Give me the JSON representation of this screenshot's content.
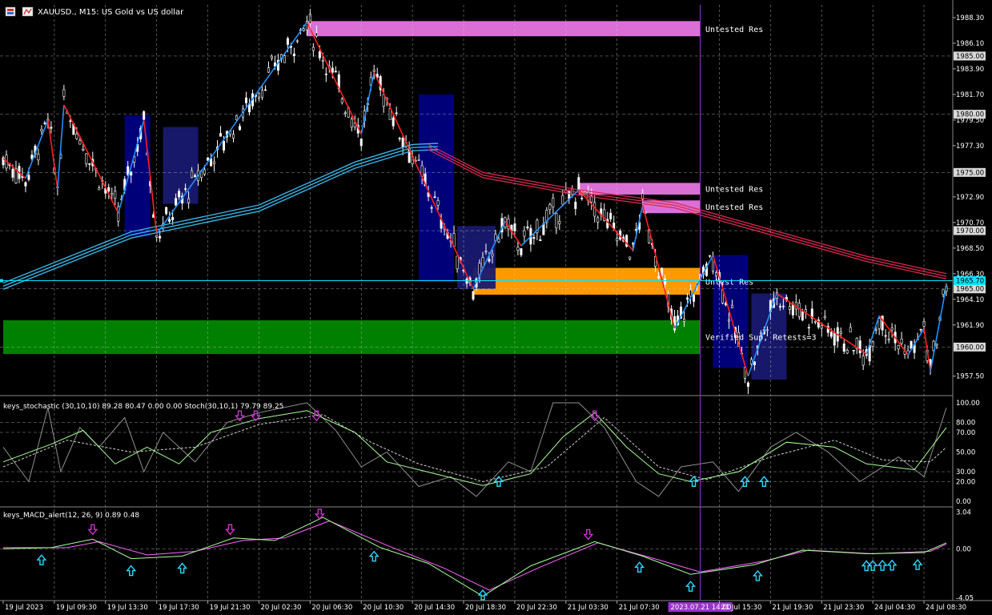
{
  "window": {
    "symbol_title": "XAUUSD., M15:  US Gold vs US dollar",
    "icons": [
      "chart-type-icon",
      "trade-icon"
    ]
  },
  "colors": {
    "background": "#000000",
    "grid": "#c8c8c8",
    "bull": "#ffffff",
    "bear": "#ffffff",
    "zigzag_up": "#1e90ff",
    "zigzag_down": "#ff2020",
    "ma": "#36b4e6",
    "ma_slow": "#dc2850",
    "zone_violet": "#da70d6",
    "zone_orange": "#ff9900",
    "zone_green": "#008000",
    "zone_navy": "#000080",
    "zone_blue": "#191970",
    "price_line": "#00e5ff",
    "stoch_main": "#a8ff9a",
    "stoch_signal": "#d0d0d0",
    "stoch_fast": "#909090",
    "macd_main": "#a8ff9a",
    "macd_signal": "#ff66ff",
    "arrow_up": "#29d9ff",
    "arrow_down": "#cc33cc",
    "axis_highlight": "#9933cc"
  },
  "price_axis": {
    "min": 1955.9,
    "max": 1989.4,
    "tick_labels": [
      "1988.30",
      "1986.10",
      "1983.90",
      "1981.70",
      "1979.50",
      "1977.30",
      "1972.90",
      "1970.70",
      "1968.50",
      "1966.30",
      "1964.10",
      "1961.90",
      "1957.50"
    ],
    "boxed_labels": [
      "1985.00",
      "1980.00",
      "1975.00",
      "1970.00",
      "1965.00",
      "1960.00"
    ],
    "current_price": "1965.70",
    "dashed_levels": [
      1985,
      1980,
      1975,
      1970,
      1965,
      1960
    ]
  },
  "zones": [
    {
      "label": "Untested Res",
      "kind": "violet",
      "from_index": 95,
      "to_index": 218,
      "top": 1988.0,
      "bottom": 1986.7
    },
    {
      "label": "Untested Res",
      "kind": "violet",
      "from_index": 180,
      "to_index": 218,
      "top": 1974.1,
      "bottom": 1973.1
    },
    {
      "label": "Untested Res",
      "kind": "violet",
      "from_index": 200,
      "to_index": 218,
      "top": 1972.6,
      "bottom": 1971.5
    },
    {
      "label": "Untest Res",
      "kind": "orange",
      "from_index": 147,
      "to_index": 218,
      "top": 1966.8,
      "bottom": 1964.5
    },
    {
      "label": "Verified Sup, Retests=3",
      "kind": "green",
      "from_index": 0,
      "to_index": 218,
      "top": 1962.3,
      "bottom": 1959.4
    }
  ],
  "blue_boxes": [
    {
      "kind": "navy",
      "from_index": 38,
      "to_index": 46,
      "top": 1979.9,
      "bottom": 1969.5
    },
    {
      "kind": "blue",
      "from_index": 50,
      "to_index": 61,
      "top": 1978.9,
      "bottom": 1972.3
    },
    {
      "kind": "navy",
      "from_index": 130,
      "to_index": 141,
      "top": 1981.7,
      "bottom": 1965.6
    },
    {
      "kind": "blue",
      "from_index": 142,
      "to_index": 154,
      "top": 1970.4,
      "bottom": 1965.0
    },
    {
      "kind": "navy",
      "from_index": 222,
      "to_index": 233,
      "top": 1967.9,
      "bottom": 1958.2
    },
    {
      "kind": "blue",
      "from_index": 234,
      "to_index": 245,
      "top": 1964.6,
      "bottom": 1957.2
    }
  ],
  "zigzag": [
    {
      "i": 0,
      "p": 1976.2
    },
    {
      "i": 7,
      "p": 1974.5
    },
    {
      "i": 14,
      "p": 1979.5
    },
    {
      "i": 17,
      "p": 1973.6
    },
    {
      "i": 19,
      "p": 1980.8
    },
    {
      "i": 36,
      "p": 1971.5
    },
    {
      "i": 44,
      "p": 1979.5
    },
    {
      "i": 48,
      "p": 1969.7
    },
    {
      "i": 95,
      "p": 1987.9
    },
    {
      "i": 112,
      "p": 1978.3
    },
    {
      "i": 116,
      "p": 1983.6
    },
    {
      "i": 147,
      "p": 1965.0
    },
    {
      "i": 157,
      "p": 1970.8
    },
    {
      "i": 162,
      "p": 1968.7
    },
    {
      "i": 180,
      "p": 1973.5
    },
    {
      "i": 197,
      "p": 1968.3
    },
    {
      "i": 200,
      "p": 1972.2
    },
    {
      "i": 210,
      "p": 1961.6
    },
    {
      "i": 222,
      "p": 1967.9
    },
    {
      "i": 233,
      "p": 1957.5
    },
    {
      "i": 242,
      "p": 1964.6
    },
    {
      "i": 270,
      "p": 1959.4
    },
    {
      "i": 274,
      "p": 1962.7
    },
    {
      "i": 283,
      "p": 1959.3
    },
    {
      "i": 288,
      "p": 1961.6
    },
    {
      "i": 290,
      "p": 1957.9
    },
    {
      "i": 295,
      "p": 1965.3
    }
  ],
  "moving_averages": {
    "fast": [
      {
        "i": 0,
        "p": 1965.5
      },
      {
        "i": 40,
        "p": 1969.9
      },
      {
        "i": 80,
        "p": 1972.2
      },
      {
        "i": 110,
        "p": 1975.9
      },
      {
        "i": 128,
        "p": 1977.4
      },
      {
        "i": 136,
        "p": 1977.5
      }
    ],
    "slow": [
      {
        "i": 133,
        "p": 1977.4
      },
      {
        "i": 150,
        "p": 1975.0
      },
      {
        "i": 180,
        "p": 1973.5
      },
      {
        "i": 210,
        "p": 1972.4
      },
      {
        "i": 240,
        "p": 1970.1
      },
      {
        "i": 270,
        "p": 1967.8
      },
      {
        "i": 295,
        "p": 1966.3
      }
    ]
  },
  "stochastic": {
    "label": "keys_stochastic (30,10,10) 89.28 80.47 0.00 0.00 Stoch(30,10,1) 79.79 89.25",
    "levels": [
      "100.00",
      "80.00",
      "70.00",
      "50.00",
      "30.00",
      "20.00",
      "0.00"
    ],
    "level_values": [
      100,
      80,
      70,
      50,
      30,
      20,
      0
    ],
    "dashed_levels": [
      80,
      70,
      30,
      20
    ],
    "main": [
      {
        "i": 0,
        "v": 40
      },
      {
        "i": 15,
        "v": 58
      },
      {
        "i": 25,
        "v": 72
      },
      {
        "i": 35,
        "v": 38
      },
      {
        "i": 45,
        "v": 55
      },
      {
        "i": 55,
        "v": 38
      },
      {
        "i": 65,
        "v": 70
      },
      {
        "i": 80,
        "v": 84
      },
      {
        "i": 95,
        "v": 92
      },
      {
        "i": 110,
        "v": 70
      },
      {
        "i": 120,
        "v": 40
      },
      {
        "i": 130,
        "v": 32
      },
      {
        "i": 150,
        "v": 16
      },
      {
        "i": 165,
        "v": 28
      },
      {
        "i": 175,
        "v": 65
      },
      {
        "i": 185,
        "v": 90
      },
      {
        "i": 195,
        "v": 55
      },
      {
        "i": 205,
        "v": 28
      },
      {
        "i": 215,
        "v": 20
      },
      {
        "i": 230,
        "v": 30
      },
      {
        "i": 245,
        "v": 60
      },
      {
        "i": 260,
        "v": 55
      },
      {
        "i": 270,
        "v": 38
      },
      {
        "i": 285,
        "v": 32
      },
      {
        "i": 295,
        "v": 75
      }
    ],
    "signal": [
      {
        "i": 0,
        "v": 35
      },
      {
        "i": 20,
        "v": 62
      },
      {
        "i": 40,
        "v": 50
      },
      {
        "i": 60,
        "v": 55
      },
      {
        "i": 80,
        "v": 78
      },
      {
        "i": 100,
        "v": 88
      },
      {
        "i": 115,
        "v": 60
      },
      {
        "i": 130,
        "v": 38
      },
      {
        "i": 150,
        "v": 20
      },
      {
        "i": 170,
        "v": 35
      },
      {
        "i": 188,
        "v": 85
      },
      {
        "i": 205,
        "v": 35
      },
      {
        "i": 220,
        "v": 22
      },
      {
        "i": 240,
        "v": 45
      },
      {
        "i": 260,
        "v": 62
      },
      {
        "i": 275,
        "v": 42
      },
      {
        "i": 290,
        "v": 40
      },
      {
        "i": 295,
        "v": 55
      }
    ],
    "fast": [
      {
        "i": 0,
        "v": 55
      },
      {
        "i": 8,
        "v": 20
      },
      {
        "i": 14,
        "v": 95
      },
      {
        "i": 18,
        "v": 30
      },
      {
        "i": 24,
        "v": 75
      },
      {
        "i": 30,
        "v": 55
      },
      {
        "i": 38,
        "v": 85
      },
      {
        "i": 44,
        "v": 30
      },
      {
        "i": 50,
        "v": 70
      },
      {
        "i": 60,
        "v": 40
      },
      {
        "i": 70,
        "v": 80
      },
      {
        "i": 80,
        "v": 90
      },
      {
        "i": 95,
        "v": 100
      },
      {
        "i": 104,
        "v": 72
      },
      {
        "i": 112,
        "v": 35
      },
      {
        "i": 120,
        "v": 50
      },
      {
        "i": 130,
        "v": 15
      },
      {
        "i": 140,
        "v": 25
      },
      {
        "i": 148,
        "v": 5
      },
      {
        "i": 158,
        "v": 40
      },
      {
        "i": 165,
        "v": 30
      },
      {
        "i": 172,
        "v": 100
      },
      {
        "i": 180,
        "v": 100
      },
      {
        "i": 188,
        "v": 75
      },
      {
        "i": 198,
        "v": 20
      },
      {
        "i": 205,
        "v": 5
      },
      {
        "i": 212,
        "v": 35
      },
      {
        "i": 222,
        "v": 40
      },
      {
        "i": 230,
        "v": 10
      },
      {
        "i": 240,
        "v": 55
      },
      {
        "i": 248,
        "v": 70
      },
      {
        "i": 258,
        "v": 50
      },
      {
        "i": 268,
        "v": 20
      },
      {
        "i": 280,
        "v": 45
      },
      {
        "i": 288,
        "v": 25
      },
      {
        "i": 295,
        "v": 95
      }
    ],
    "up_arrows": [
      155,
      216,
      232,
      238
    ],
    "down_arrows": [
      74,
      79,
      98,
      185
    ]
  },
  "macd": {
    "label": "keys_MACD_alert(12, 26, 9) 0.89 0.48",
    "levels": [
      "3.04",
      "0.00",
      "-4.05"
    ],
    "level_values": [
      3.04,
      0,
      -4.05
    ],
    "min": -4.2,
    "max": 3.4,
    "main": [
      {
        "i": 0,
        "v": 0.0
      },
      {
        "i": 15,
        "v": 0.1
      },
      {
        "i": 28,
        "v": 0.8
      },
      {
        "i": 40,
        "v": -0.8
      },
      {
        "i": 56,
        "v": -0.6
      },
      {
        "i": 72,
        "v": 0.9
      },
      {
        "i": 85,
        "v": 0.7
      },
      {
        "i": 100,
        "v": 2.6
      },
      {
        "i": 118,
        "v": 0.1
      },
      {
        "i": 133,
        "v": -1.2
      },
      {
        "i": 150,
        "v": -3.9
      },
      {
        "i": 165,
        "v": -1.4
      },
      {
        "i": 185,
        "v": 0.6
      },
      {
        "i": 200,
        "v": -0.6
      },
      {
        "i": 215,
        "v": -2.1
      },
      {
        "i": 235,
        "v": -1.3
      },
      {
        "i": 250,
        "v": -0.1
      },
      {
        "i": 270,
        "v": -0.4
      },
      {
        "i": 288,
        "v": -0.3
      },
      {
        "i": 295,
        "v": 0.5
      }
    ],
    "signal": [
      {
        "i": 0,
        "v": 0.1
      },
      {
        "i": 20,
        "v": 0.1
      },
      {
        "i": 30,
        "v": 0.6
      },
      {
        "i": 45,
        "v": -0.5
      },
      {
        "i": 60,
        "v": -0.2
      },
      {
        "i": 75,
        "v": 0.7
      },
      {
        "i": 88,
        "v": 0.9
      },
      {
        "i": 102,
        "v": 2.3
      },
      {
        "i": 120,
        "v": 0.3
      },
      {
        "i": 138,
        "v": -1.6
      },
      {
        "i": 152,
        "v": -3.4
      },
      {
        "i": 168,
        "v": -1.5
      },
      {
        "i": 186,
        "v": 0.5
      },
      {
        "i": 205,
        "v": -0.9
      },
      {
        "i": 218,
        "v": -1.9
      },
      {
        "i": 238,
        "v": -1.0
      },
      {
        "i": 252,
        "v": -0.1
      },
      {
        "i": 272,
        "v": -0.4
      },
      {
        "i": 290,
        "v": -0.2
      },
      {
        "i": 295,
        "v": 0.4
      }
    ],
    "up_arrows": [
      12,
      40,
      56,
      116,
      150,
      199,
      215,
      236,
      270,
      272,
      275,
      278,
      286
    ],
    "down_arrows": [
      28,
      71,
      99,
      183
    ]
  },
  "time_axis": {
    "bar_count": 297,
    "labels": [
      {
        "text": "19 Jul 2023",
        "i": 0
      },
      {
        "text": "19 Jul 09:30",
        "i": 16
      },
      {
        "text": "19 Jul 13:30",
        "i": 32
      },
      {
        "text": "19 Jul 17:30",
        "i": 48
      },
      {
        "text": "19 Jul 21:30",
        "i": 64
      },
      {
        "text": "20 Jul 02:30",
        "i": 80
      },
      {
        "text": "20 Jul 06:30",
        "i": 96
      },
      {
        "text": "20 Jul 10:30",
        "i": 112
      },
      {
        "text": "20 Jul 14:30",
        "i": 128
      },
      {
        "text": "20 Jul 18:30",
        "i": 144
      },
      {
        "text": "20 Jul 22:30",
        "i": 160
      },
      {
        "text": "21 Jul 03:30",
        "i": 176
      },
      {
        "text": "21 Jul 07:30",
        "i": 192
      },
      {
        "text": "2023.07.21 14:00",
        "i": 218
      },
      {
        "text": "21 Jul 15:30",
        "i": 224
      },
      {
        "text": "21 Jul 19:30",
        "i": 240
      },
      {
        "text": "21 Jul 23:30",
        "i": 256
      },
      {
        "text": "24 Jul 04:30",
        "i": 272
      },
      {
        "text": "24 Jul 08:30",
        "i": 288
      }
    ],
    "vertical_grid_indices": [
      16,
      32,
      48,
      64,
      80,
      96,
      112,
      128,
      144,
      160,
      176,
      192,
      224,
      240,
      256,
      272,
      288
    ],
    "cursor_index": 218
  }
}
